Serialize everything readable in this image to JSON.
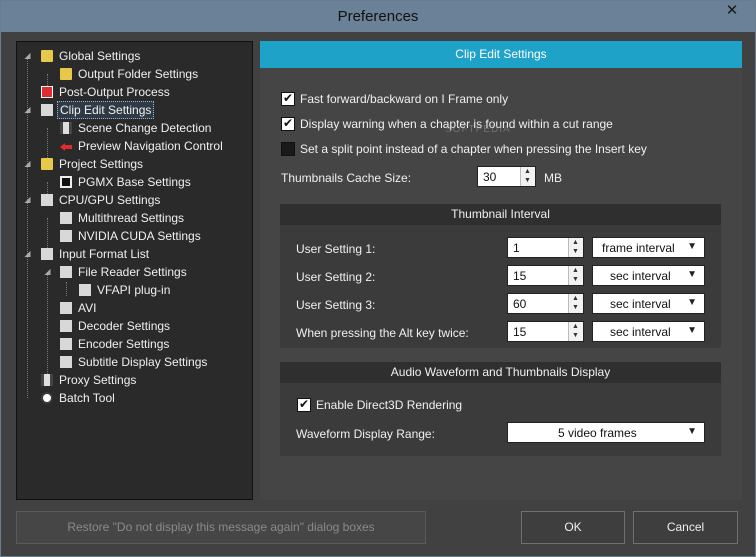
{
  "window": {
    "title": "Preferences",
    "close_glyph": "✕"
  },
  "tree": {
    "items": [
      {
        "label": "Global Settings",
        "icon": "folder-icon"
      },
      {
        "label": "Output Folder Settings",
        "icon": "folder-icon"
      },
      {
        "label": "Post-Output Process",
        "icon": "red-square-icon"
      },
      {
        "label": "Clip Edit Settings",
        "icon": "document-icon"
      },
      {
        "label": "Scene Change Detection",
        "icon": "film-icon"
      },
      {
        "label": "Preview Navigation Control",
        "icon": "arrow-icon"
      },
      {
        "label": "Project Settings",
        "icon": "folder-document-icon"
      },
      {
        "label": "PGMX Base Settings",
        "icon": "pgmx-icon"
      },
      {
        "label": "CPU/GPU Settings",
        "icon": "document-icon"
      },
      {
        "label": "Multithread Settings",
        "icon": "document-icon"
      },
      {
        "label": "NVIDIA CUDA Settings",
        "icon": "document-icon"
      },
      {
        "label": "Input Format List",
        "icon": "document-icon"
      },
      {
        "label": "File Reader Settings",
        "icon": "monitor-icon"
      },
      {
        "label": "VFAPI plug-in",
        "icon": "monitor-icon"
      },
      {
        "label": "AVI",
        "icon": "document-icon"
      },
      {
        "label": "Decoder Settings",
        "icon": "document-icon"
      },
      {
        "label": "Encoder Settings",
        "icon": "document-icon"
      },
      {
        "label": "Subtitle Display Settings",
        "icon": "document-icon"
      },
      {
        "label": "Proxy Settings",
        "icon": "film-icon"
      },
      {
        "label": "Batch Tool",
        "icon": "clock-icon"
      }
    ]
  },
  "panel": {
    "title": "Clip Edit Settings",
    "options": [
      {
        "label": "Fast forward/backward on I Frame only",
        "checked": true
      },
      {
        "label": "Display warning when a chapter is found within a cut range",
        "checked": true
      },
      {
        "label": "Set a split point instead of a chapter when pressing the Insert key",
        "checked": false
      }
    ],
    "cache": {
      "label": "Thumbnails Cache Size:",
      "value": "30",
      "unit": "MB"
    },
    "thumbnail_interval": {
      "title": "Thumbnail Interval",
      "rows": [
        {
          "label": "User Setting 1:",
          "value": "1",
          "unit": "frame interval"
        },
        {
          "label": "User Setting 2:",
          "value": "15",
          "unit": "sec interval"
        },
        {
          "label": "User Setting 3:",
          "value": "60",
          "unit": "sec interval"
        },
        {
          "label": "When pressing the Alt key twice:",
          "value": "15",
          "unit": "sec interval"
        }
      ]
    },
    "audio": {
      "title": "Audio Waveform and Thumbnails Display",
      "enable_label": "Enable Direct3D Rendering",
      "enable_checked": true,
      "range_label": "Waveform Display Range:",
      "range_value": "5 video frames"
    }
  },
  "buttons": {
    "restore": "Restore \"Do not display this message again\" dialog boxes",
    "ok": "OK",
    "cancel": "Cancel"
  },
  "watermark": "SOFTPEDIA",
  "colors": {
    "accent": "#1ea2c7",
    "titlebar": "#6b8197"
  }
}
